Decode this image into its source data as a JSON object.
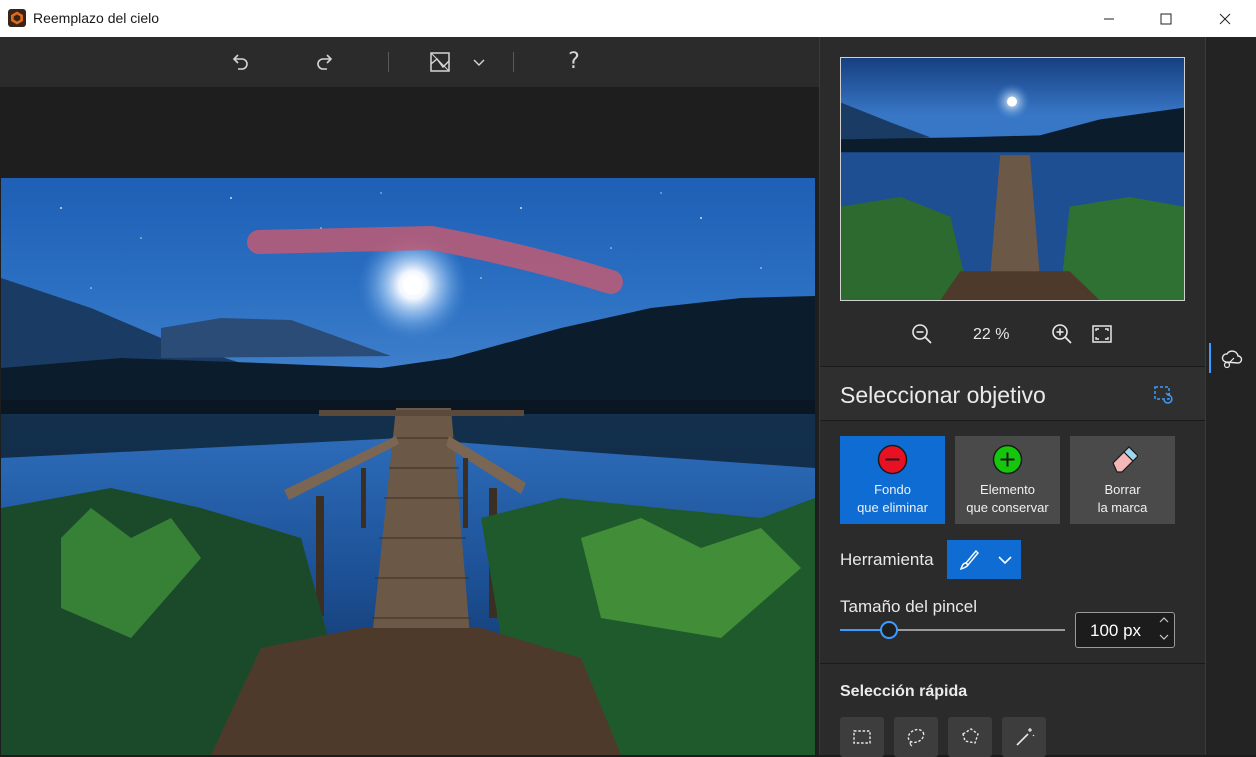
{
  "window": {
    "title": "Reemplazo del cielo"
  },
  "toolbar": {
    "undo_icon": "undo-icon",
    "redo_icon": "redo-icon",
    "view_icon": "image-view-icon",
    "help_label": "?"
  },
  "preview": {
    "zoom_value": "22 %"
  },
  "select_target": {
    "title": "Seleccionar objetivo",
    "modes": [
      {
        "line1": "Fondo",
        "line2": "que eliminar",
        "icon": "minus-circle-icon",
        "active": true
      },
      {
        "line1": "Elemento",
        "line2": "que conservar",
        "icon": "plus-circle-icon",
        "active": false
      },
      {
        "line1": "Borrar",
        "line2": "la marca",
        "icon": "eraser-icon",
        "active": false
      }
    ],
    "tool_label": "Herramienta",
    "brush_label": "Tamaño del pincel",
    "brush_size": "100 px",
    "brush_slider_fraction": 0.22
  },
  "quick_selection": {
    "title": "Selección rápida"
  },
  "colors": {
    "accent": "#0f6cd2",
    "slider": "#3b9cff",
    "stroke": "#c05a73"
  }
}
